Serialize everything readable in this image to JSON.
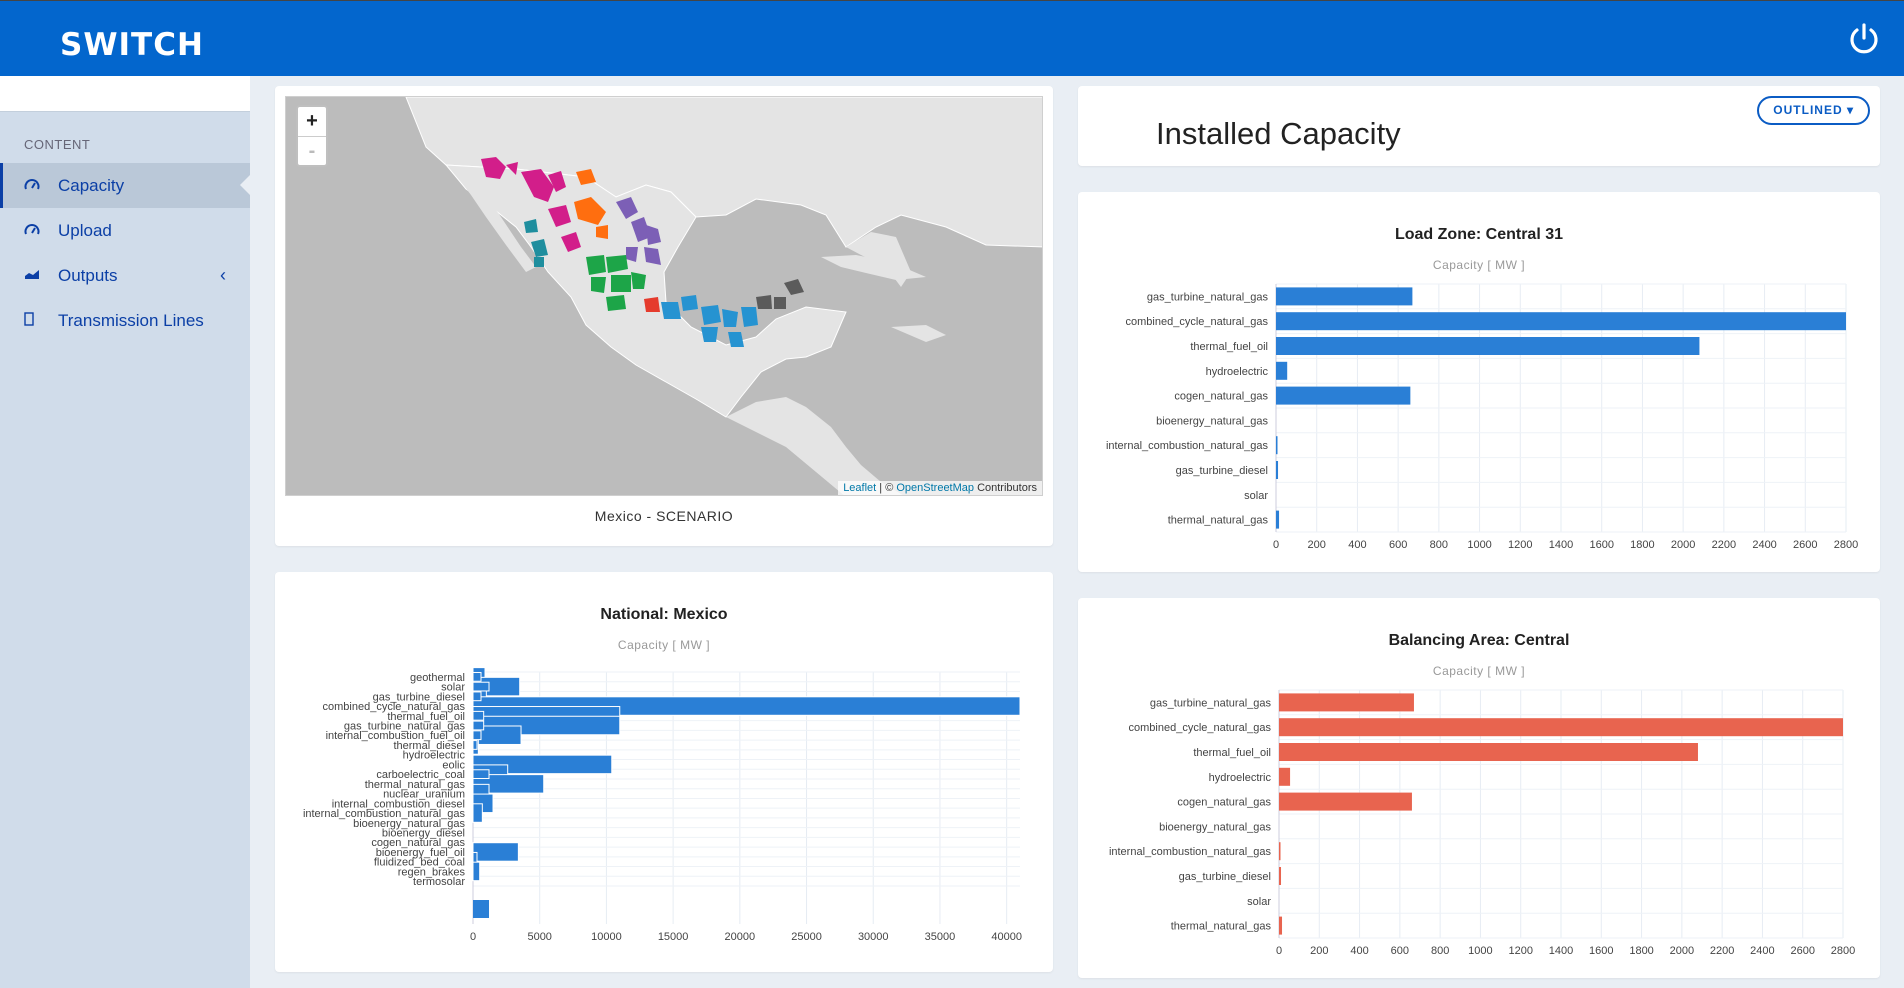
{
  "header": {
    "logo": "SWITCH",
    "power_icon": "power-icon"
  },
  "sidebar": {
    "heading": "CONTENT",
    "items": [
      {
        "label": "Capacity",
        "icon": "gauge-icon",
        "active": true
      },
      {
        "label": "Upload",
        "icon": "gauge-icon"
      },
      {
        "label": "Outputs",
        "icon": "area-chart-icon",
        "expandable": true
      },
      {
        "label": "Transmission Lines",
        "icon": "file-icon"
      }
    ]
  },
  "map_panel": {
    "zoom_in": "+",
    "zoom_out": "-",
    "attribution_leaflet": "Leaflet",
    "attribution_sep": " | © ",
    "attribution_osm": "OpenStreetMap",
    "attribution_tail": " Contributors",
    "caption": "Mexico - SCENARIO"
  },
  "capacity_header": {
    "title": "Installed Capacity",
    "button": "OUTLINED"
  },
  "colors": {
    "blue_bar": "#2a7fd6",
    "red_bar": "#e8644f",
    "header": "#0366cd"
  },
  "chart_data": [
    {
      "type": "bar",
      "orientation": "horizontal",
      "title": "Load Zone: Central 31",
      "subtitle": "Capacity [ MW ]",
      "categories": [
        "gas_turbine_natural_gas",
        "combined_cycle_natural_gas",
        "thermal_fuel_oil",
        "hydroelectric",
        "cogen_natural_gas",
        "bioenergy_natural_gas",
        "internal_combustion_natural_gas",
        "gas_turbine_diesel",
        "solar",
        "thermal_natural_gas"
      ],
      "values": [
        670,
        2800,
        2080,
        55,
        660,
        0,
        5,
        10,
        0,
        15
      ],
      "xlim": [
        0,
        2800
      ],
      "xticks": [
        0,
        200,
        400,
        600,
        800,
        1000,
        1200,
        1400,
        1600,
        1800,
        2000,
        2200,
        2400,
        2600,
        2800
      ],
      "color": "#2a7fd6"
    },
    {
      "type": "bar",
      "orientation": "horizontal",
      "title": "National: Mexico",
      "subtitle": "Capacity [ MW ]",
      "categories": [
        "geothermal",
        "solar",
        "gas_turbine_diesel",
        "combined_cycle_natural_gas",
        "thermal_fuel_oil",
        "gas_turbine_natural_gas",
        "internal_combustion_fuel_oil",
        "thermal_diesel",
        "hydroelectric",
        "eolic",
        "carboelectric_coal",
        "thermal_natural_gas",
        "nuclear_uranium",
        "internal_combustion_diesel",
        "internal_combustion_natural_gas",
        "bioenergy_natural_gas",
        "bioenergy_diesel",
        "cogen_natural_gas",
        "bioenergy_fuel_oil",
        "fluidized_bed_coal",
        "regen_brakes",
        "termosolar"
      ],
      "series": [
        {
          "values": [
            900,
            3500,
            1000,
            41000,
            11000,
            11000,
            3600,
            400,
            0,
            10400,
            2600,
            5300,
            1200,
            1500,
            700,
            0,
            0,
            0,
            3400,
            300,
            500,
            0
          ]
        },
        {
          "values": [
            600,
            1200,
            600,
            0,
            800,
            800,
            600,
            300,
            0,
            0,
            1200,
            0,
            0,
            0,
            0,
            0,
            0,
            0,
            0,
            0,
            0,
            0
          ]
        },
        {
          "values": [
            1200
          ]
        }
      ],
      "xlim": [
        0,
        41000
      ],
      "xticks": [
        0,
        5000,
        10000,
        15000,
        20000,
        25000,
        30000,
        35000,
        40000
      ],
      "color": "#2a7fd6"
    },
    {
      "type": "bar",
      "orientation": "horizontal",
      "title": "Balancing Area: Central",
      "subtitle": "Capacity [ MW ]",
      "categories": [
        "gas_turbine_natural_gas",
        "combined_cycle_natural_gas",
        "thermal_fuel_oil",
        "hydroelectric",
        "cogen_natural_gas",
        "bioenergy_natural_gas",
        "internal_combustion_natural_gas",
        "gas_turbine_diesel",
        "solar",
        "thermal_natural_gas"
      ],
      "values": [
        670,
        2800,
        2080,
        55,
        660,
        0,
        5,
        10,
        0,
        15
      ],
      "xlim": [
        0,
        2800
      ],
      "xticks": [
        0,
        200,
        400,
        600,
        800,
        1000,
        1200,
        1400,
        1600,
        1800,
        2000,
        2200,
        2400,
        2600,
        2800
      ],
      "color": "#e8644f"
    }
  ]
}
